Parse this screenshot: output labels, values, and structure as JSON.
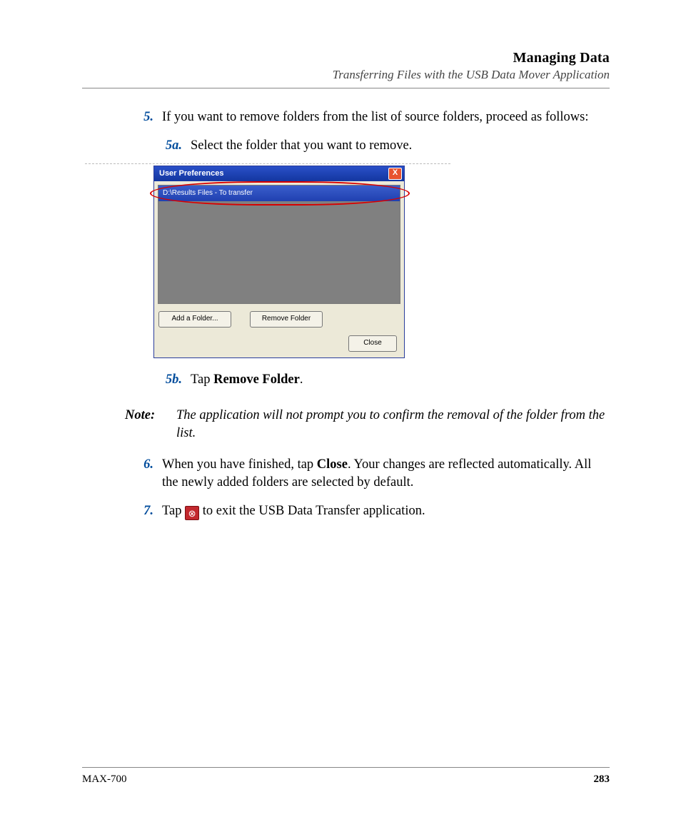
{
  "header": {
    "title": "Managing Data",
    "subtitle": "Transferring Files with the USB Data Mover Application"
  },
  "steps": {
    "s5": {
      "num": "5.",
      "text": "If you want to remove folders from the list of source folders, proceed as follows:"
    },
    "s5a": {
      "num": "5a.",
      "text": "Select the folder that you want to remove."
    },
    "s5b": {
      "num": "5b.",
      "prefix": "Tap ",
      "bold": "Remove Folder",
      "suffix": "."
    },
    "s6": {
      "num": "6.",
      "prefix": "When you have finished, tap ",
      "bold": "Close",
      "suffix": ". Your changes are reflected automatically. All the newly added folders are selected by default."
    },
    "s7": {
      "num": "7.",
      "prefix": "Tap ",
      "suffix": " to exit the USB Data Transfer application."
    }
  },
  "note": {
    "label": "Note:",
    "text": "The application will not prompt you to confirm the removal of the folder from the list."
  },
  "dialog": {
    "title": "User Preferences",
    "item": "D:\\Results Files - To transfer",
    "addBtn": "Add a Folder...",
    "removeBtn": "Remove Folder",
    "closeBtn": "Close",
    "closeX": "X"
  },
  "exitIconGlyph": "⊗",
  "footer": {
    "model": "MAX-700",
    "page": "283"
  }
}
